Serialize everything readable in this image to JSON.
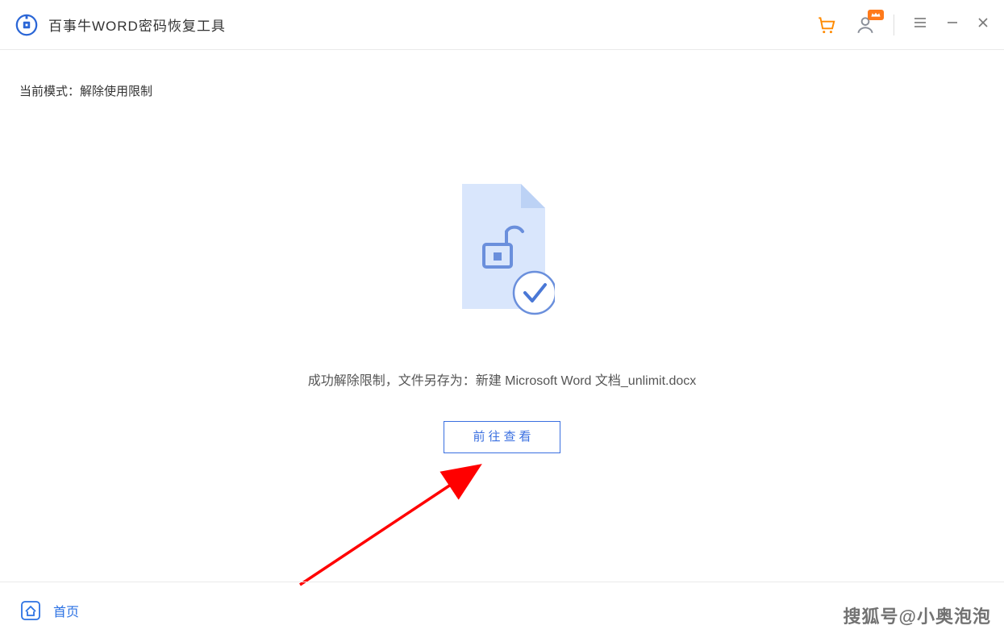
{
  "header": {
    "app_title": "百事牛WORD密码恢复工具"
  },
  "content": {
    "mode_label": "当前模式：解除使用限制",
    "success_prefix": "成功解除限制，文件另存为：",
    "saved_filename": "新建 Microsoft Word 文档_unlimit.docx",
    "go_view_btn": "前往查看"
  },
  "footer": {
    "home_label": "首页"
  },
  "watermark": "搜狐号@小奥泡泡"
}
